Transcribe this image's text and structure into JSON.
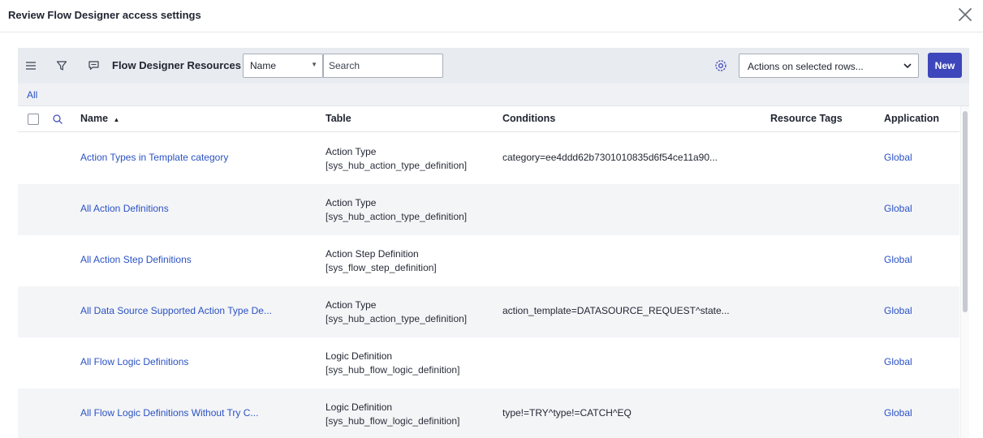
{
  "modal": {
    "title": "Review Flow Designer access settings",
    "close_icon": "close-icon"
  },
  "toolbar": {
    "menu_icon": "hamburger-icon",
    "filter_icon": "funnel-icon",
    "comment_icon": "speech-bubble-icon",
    "list_title": "Flow Designer Resources",
    "field_select_value": "Name",
    "search_placeholder": "Search",
    "settings_icon": "gear-icon",
    "actions_select_value": "Actions on selected rows...",
    "new_label": "New"
  },
  "breadcrumb": {
    "all_label": "All"
  },
  "columns": {
    "name": "Name",
    "table": "Table",
    "conditions": "Conditions",
    "resource_tags": "Resource Tags",
    "application": "Application"
  },
  "rows": [
    {
      "name": "Action Types in Template category",
      "table_name": "Action Type",
      "table_code": "[sys_hub_action_type_definition]",
      "conditions": "category=ee4ddd62b7301010835d6f54ce11a90...",
      "resource_tags": "",
      "application": "Global"
    },
    {
      "name": "All Action Definitions",
      "table_name": "Action Type",
      "table_code": "[sys_hub_action_type_definition]",
      "conditions": "",
      "resource_tags": "",
      "application": "Global"
    },
    {
      "name": "All Action Step Definitions",
      "table_name": "Action Step Definition",
      "table_code": "[sys_flow_step_definition]",
      "conditions": "",
      "resource_tags": "",
      "application": "Global"
    },
    {
      "name": "All Data Source Supported Action Type De...",
      "table_name": "Action Type",
      "table_code": "[sys_hub_action_type_definition]",
      "conditions": "action_template=DATASOURCE_REQUEST^state...",
      "resource_tags": "",
      "application": "Global"
    },
    {
      "name": "All Flow Logic Definitions",
      "table_name": "Logic Definition",
      "table_code": "[sys_hub_flow_logic_definition]",
      "conditions": "",
      "resource_tags": "",
      "application": "Global"
    },
    {
      "name": "All Flow Logic Definitions Without Try C...",
      "table_name": "Logic Definition",
      "table_code": "[sys_hub_flow_logic_definition]",
      "conditions": "type!=TRY^type!=CATCH^EQ",
      "resource_tags": "",
      "application": "Global"
    }
  ],
  "colors": {
    "link": "#2b52c4",
    "primary_button": "#3e46bb",
    "toolbar_bg": "#e8ebf0",
    "alt_row_bg": "#f4f5f7"
  }
}
